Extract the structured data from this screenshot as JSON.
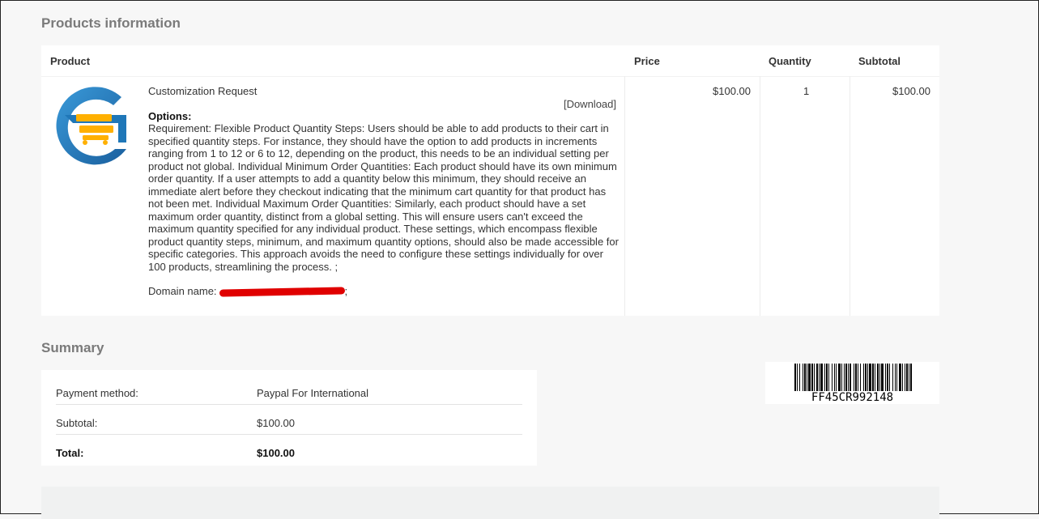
{
  "products": {
    "title": "Products information",
    "headers": {
      "product": "Product",
      "price": "Price",
      "quantity": "Quantity",
      "subtotal": "Subtotal"
    },
    "item": {
      "name": "Customization Request",
      "download_label": "[Download]",
      "options_label": "Options:",
      "options_text": "Requirement: Flexible Product Quantity Steps: Users should be able to add products to their cart in specified quantity steps. For instance, they should have the option to add products in increments ranging from 1 to 12 or 6 to 12, depending on the product, this needs to be an individual setting per product not global. Individual Minimum Order Quantities: Each product should have its own minimum order quantity. If a user attempts to add a quantity below this minimum, they should receive an immediate alert before they checkout indicating that the minimum cart quantity for that product has not been met. Individual Maximum Order Quantities: Similarly, each product should have a set maximum order quantity, distinct from a global setting. This will ensure users can't exceed the maximum quantity specified for any individual product. These settings, which encompass flexible product quantity steps, minimum, and maximum quantity options, should also be made accessible for specific categories. This approach avoids the need to configure these settings individually for over 100 products, streamlining the process. ;",
      "domain_label": "Domain name:",
      "domain_suffix": ";",
      "price": "$100.00",
      "quantity": "1",
      "subtotal": "$100.00"
    }
  },
  "summary": {
    "title": "Summary",
    "rows": [
      {
        "label": "Payment method:",
        "value": "Paypal For International"
      },
      {
        "label": "Subtotal:",
        "value": "$100.00"
      },
      {
        "label": "Total:",
        "value": "$100.00"
      }
    ]
  },
  "barcode": {
    "code": "FF45CR992148"
  },
  "colors": {
    "logo_blue": "#1f77b8",
    "logo_orange": "#ffb000",
    "redaction": "#e00000"
  },
  "icons": {
    "product_logo": "cart-logo-icon"
  }
}
